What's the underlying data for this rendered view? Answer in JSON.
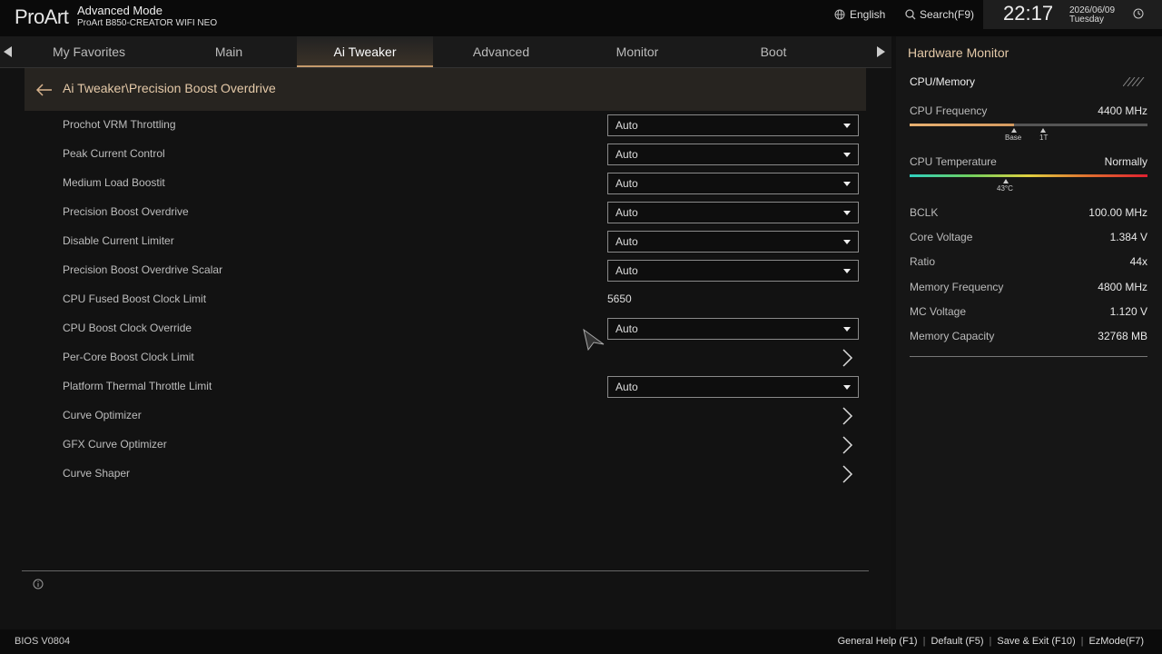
{
  "header": {
    "logo": "ProArt",
    "mode": "Advanced Mode",
    "model": "ProArt B850-CREATOR WIFI NEO",
    "language": "English",
    "search": "Search(F9)",
    "time": "22:17",
    "date": "2026/06/09",
    "day": "Tuesday"
  },
  "tabs": [
    {
      "label": "My Favorites"
    },
    {
      "label": "Main"
    },
    {
      "label": "Ai Tweaker",
      "active": true
    },
    {
      "label": "Advanced"
    },
    {
      "label": "Monitor"
    },
    {
      "label": "Boot"
    }
  ],
  "breadcrumb": "Ai Tweaker\\Precision Boost Overdrive",
  "settings": [
    {
      "label": "Prochot VRM Throttling",
      "type": "select",
      "value": "Auto"
    },
    {
      "label": "Peak Current Control",
      "type": "select",
      "value": "Auto"
    },
    {
      "label": "Medium Load Boostit",
      "type": "select",
      "value": "Auto"
    },
    {
      "label": "Precision Boost Overdrive",
      "type": "select",
      "value": "Auto"
    },
    {
      "label": "Disable Current Limiter",
      "type": "select",
      "value": "Auto"
    },
    {
      "label": "Precision Boost Overdrive Scalar",
      "type": "select",
      "value": "Auto"
    },
    {
      "label": "CPU Fused Boost Clock Limit",
      "type": "text",
      "value": "5650"
    },
    {
      "label": "CPU Boost Clock Override",
      "type": "select",
      "value": "Auto"
    },
    {
      "label": "Per-Core Boost Clock Limit",
      "type": "submenu"
    },
    {
      "label": "Platform Thermal Throttle Limit",
      "type": "select",
      "value": "Auto"
    },
    {
      "label": "Curve Optimizer",
      "type": "submenu"
    },
    {
      "label": "GFX Curve Optimizer",
      "type": "submenu"
    },
    {
      "label": "Curve Shaper",
      "type": "submenu"
    }
  ],
  "hardware_monitor": {
    "title": "Hardware Monitor",
    "section": "CPU/Memory",
    "cpu_frequency": {
      "label": "CPU Frequency",
      "value": "4400 MHz",
      "fill_fraction": 0.44,
      "markers": [
        "Base",
        "1T"
      ]
    },
    "cpu_temperature": {
      "label": "CPU Temperature",
      "value": "Normally",
      "marker": "43°C"
    },
    "stats": [
      {
        "label": "BCLK",
        "value": "100.00 MHz"
      },
      {
        "label": "Core Voltage",
        "value": "1.384 V"
      },
      {
        "label": "Ratio",
        "value": "44x"
      },
      {
        "label": "Memory Frequency",
        "value": "4800 MHz"
      },
      {
        "label": "MC Voltage",
        "value": "1.120 V"
      },
      {
        "label": "Memory Capacity",
        "value": "32768 MB"
      }
    ]
  },
  "footer": {
    "bios": "BIOS V0804",
    "keys": [
      "General Help (F1)",
      "Default (F5)",
      "Save & Exit (F10)",
      "EzMode(F7)"
    ]
  },
  "colors": {
    "accent": "#e4c9a8",
    "tab_underline": "#c49a6c"
  }
}
